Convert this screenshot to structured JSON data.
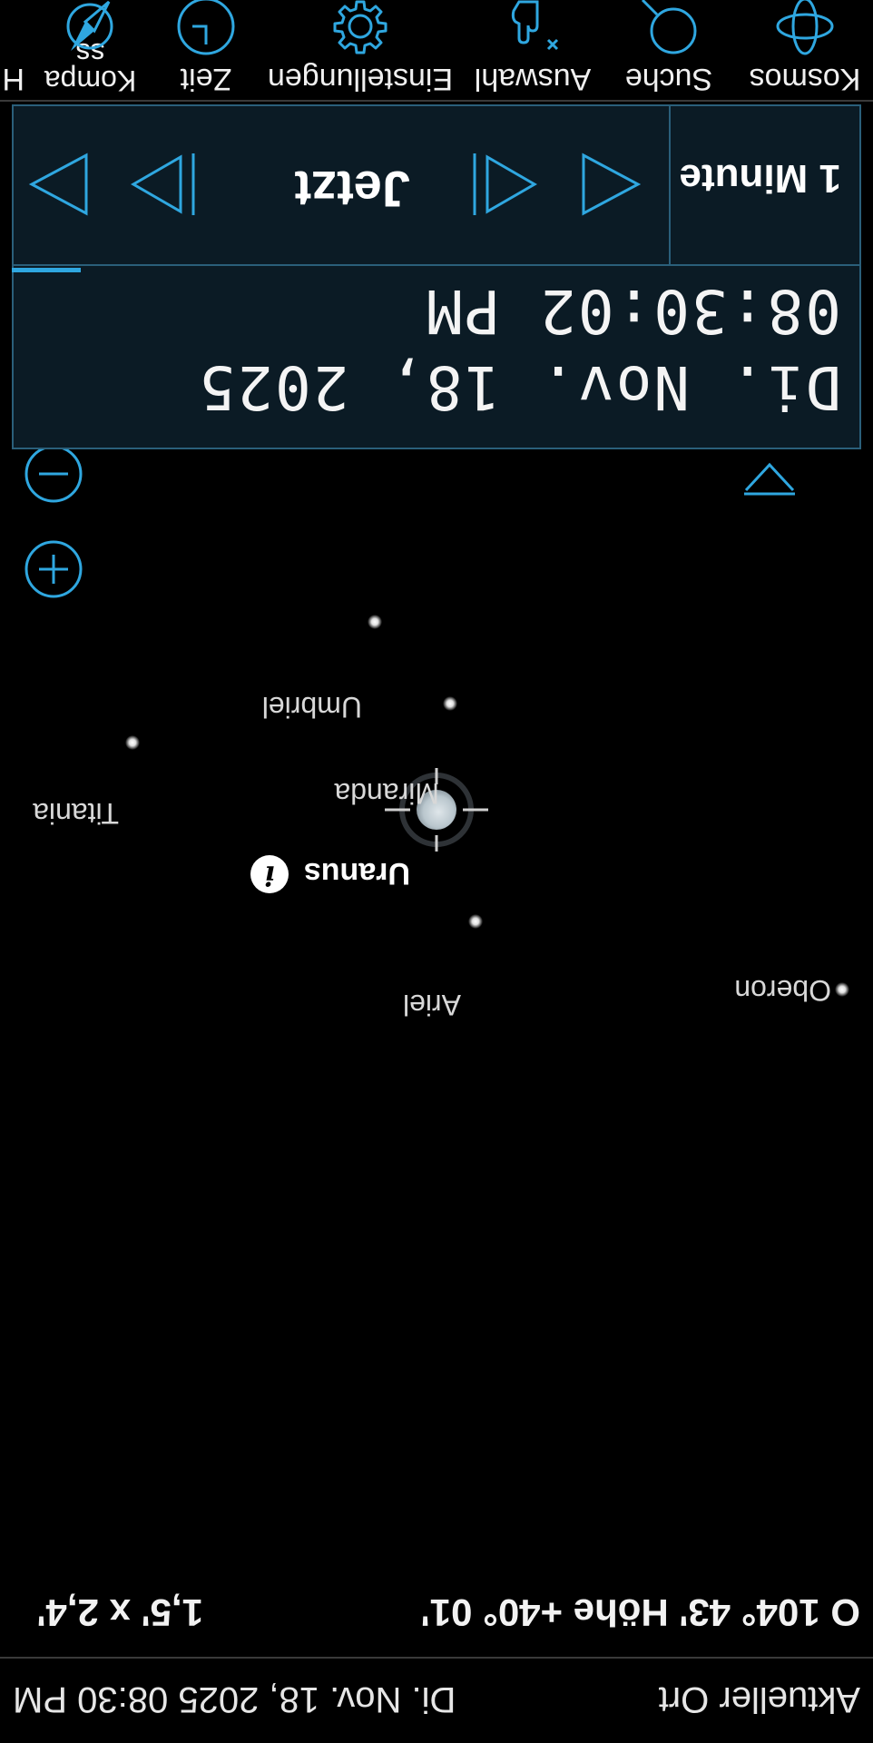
{
  "status": {
    "location": "Aktueller Ort",
    "datetime": "Di. Nov. 18, 2025  08:30 PM"
  },
  "info": {
    "coordinates": "O  104° 43' Höhe +40° 01'",
    "field_size": "1,5' x 2,4'"
  },
  "sky": {
    "planet": "Uranus",
    "moons": [
      "Oberon",
      "Ariel",
      "Miranda",
      "Titania",
      "Umbriel"
    ]
  },
  "time_panel": {
    "date": "Di. Nov. 18, 2025",
    "time": "08:30:02 PM",
    "step": "1 Minute",
    "now_label": "Jetzt"
  },
  "toolbar": {
    "items": [
      {
        "label": "Kosmos",
        "icon": "orbit-icon"
      },
      {
        "label": "Suche",
        "icon": "search-icon"
      },
      {
        "label": "Auswahl",
        "icon": "pointer-hand-icon"
      },
      {
        "label": "Einstellungen",
        "icon": "gear-icon"
      },
      {
        "label": "Zeit",
        "icon": "clock-icon"
      },
      {
        "label": "Kompa\nss",
        "icon": "compass-icon"
      },
      {
        "label": "H",
        "icon": "help-icon"
      }
    ]
  },
  "colors": {
    "accent": "#2fa7e0",
    "panel_bg": "#0b1b25",
    "panel_border": "#2a5f7a"
  }
}
